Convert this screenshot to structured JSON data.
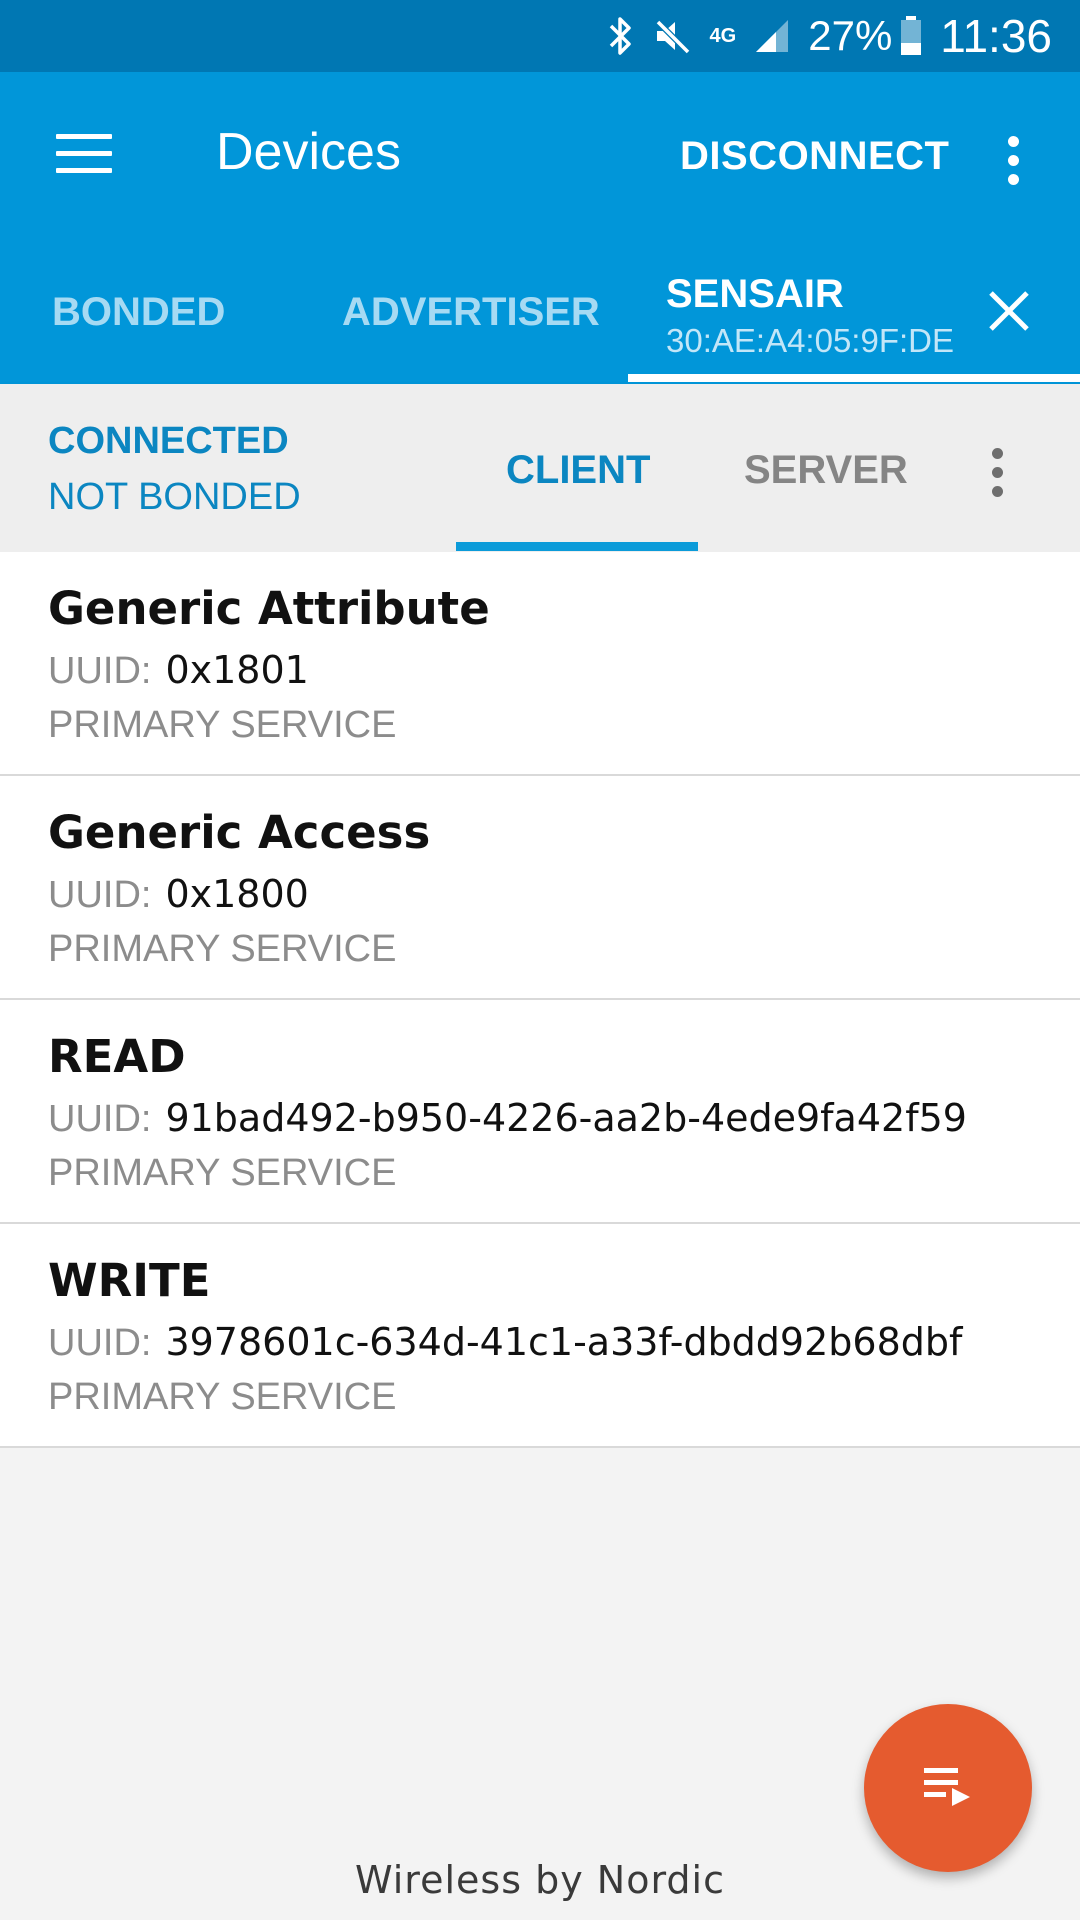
{
  "status_bar": {
    "network": "4G",
    "battery": "27%",
    "time": "11:36",
    "icons": [
      "bluetooth-icon",
      "mute-icon",
      "network-4g-icon",
      "signal-icon",
      "battery-icon"
    ]
  },
  "app_bar": {
    "title": "Devices",
    "disconnect_label": "DISCONNECT",
    "color": "#0196d9"
  },
  "device_tabs": [
    {
      "label": "BONDED"
    },
    {
      "label": "ADVERTISER"
    },
    {
      "label": "SENSAIR",
      "address": "30:AE:A4:05:9F:DE",
      "active": true
    }
  ],
  "connection": {
    "status": "CONNECTED",
    "bond": "NOT BONDED",
    "tabs": [
      {
        "label": "CLIENT",
        "active": true
      },
      {
        "label": "SERVER"
      }
    ]
  },
  "services": [
    {
      "name": "Generic Attribute",
      "uuid_label": "UUID:",
      "uuid": "0x1801",
      "type": "PRIMARY SERVICE"
    },
    {
      "name": "Generic Access",
      "uuid_label": "UUID:",
      "uuid": "0x1800",
      "type": "PRIMARY SERVICE"
    },
    {
      "name": "READ",
      "uuid_label": "UUID:",
      "uuid": "91bad492-b950-4226-aa2b-4ede9fa42f59",
      "type": "PRIMARY SERVICE"
    },
    {
      "name": "WRITE",
      "uuid_label": "UUID:",
      "uuid": "3978601c-634d-41c1-a33f-dbdd92b68dbf",
      "type": "PRIMARY SERVICE"
    }
  ],
  "fab": {
    "icon": "log-playlist-icon",
    "color": "#e55b2f"
  },
  "footer": "Wireless by Nordic"
}
